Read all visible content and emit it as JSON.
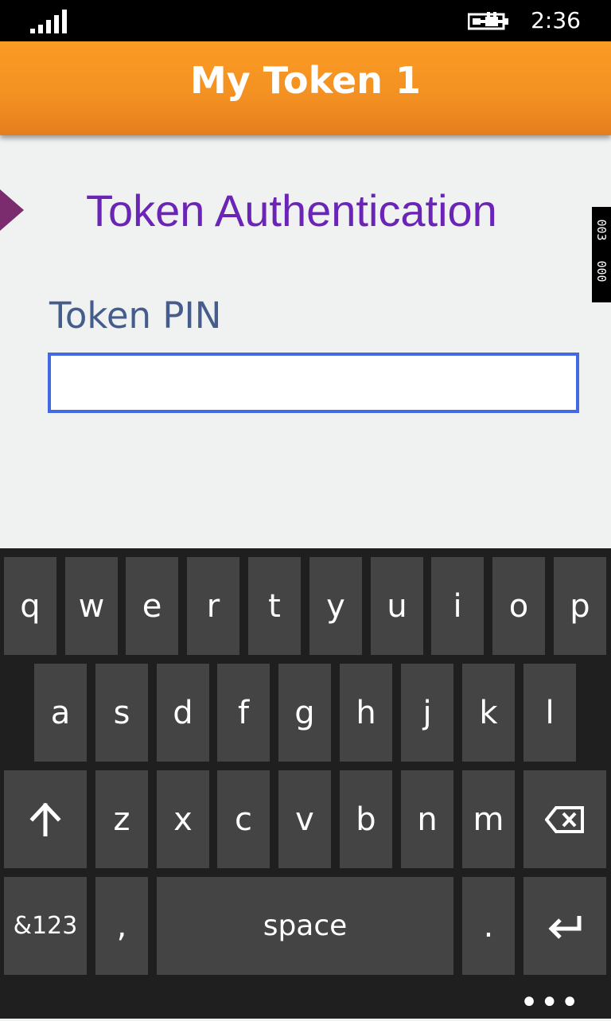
{
  "status": {
    "time": "2:36"
  },
  "app": {
    "title": "My Token 1"
  },
  "auth": {
    "title": "Token Authentication",
    "pin_label": "Token PIN",
    "pin_value": "",
    "side_tab": [
      "003",
      "000"
    ]
  },
  "keyboard": {
    "row1": [
      "q",
      "w",
      "e",
      "r",
      "t",
      "y",
      "u",
      "i",
      "o",
      "p"
    ],
    "row2": [
      "a",
      "s",
      "d",
      "f",
      "g",
      "h",
      "j",
      "k",
      "l"
    ],
    "row3": [
      "z",
      "x",
      "c",
      "v",
      "b",
      "n",
      "m"
    ],
    "numbers": "&123",
    "comma": ",",
    "space": "space",
    "period": ".",
    "more": "•••",
    "icons": {
      "shift": "shift-icon",
      "backspace": "backspace-icon",
      "enter": "enter-icon"
    }
  }
}
